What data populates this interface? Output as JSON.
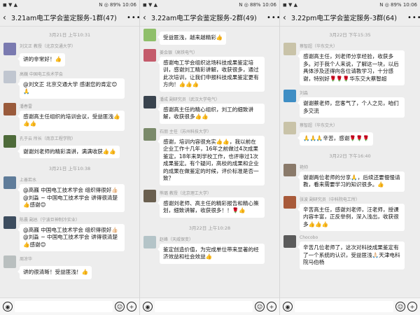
{
  "status": [
    "◼ ▼ ▲",
    "🔋89% ■■ 10:06"
  ],
  "panels": [
    {
      "status_left": "◼ ▼ ▲",
      "status_right": "N ◎ 89%  10:06",
      "title": "3.21am电工学会鉴定服务-1群(47)",
      "messages": [
        {
          "type": "ts",
          "text": "3月21日 上午10:31"
        },
        {
          "type": "msg",
          "avatar": "#7a7ab0",
          "name": "刘文正 教授（北京交通大学）",
          "text": "讲的非常好！👍"
        },
        {
          "type": "msg",
          "avatar": "#c0c6d0",
          "name": "高巍 中国电工技术学会",
          "text": "@刘文正  北京交通大学 感谢您的肯定😊🙏"
        },
        {
          "type": "msg",
          "avatar": "#9a5b3c",
          "name": "潘春雷",
          "text": "感谢高主任组织的培训会议，受益匪浅👍👍👍"
        },
        {
          "type": "msg",
          "avatar": "#4e6b3a",
          "name": "孔于云 所长（南京工程学院）",
          "text": "谢谢刘老师的精彩演讲，满满收获👍👍"
        },
        {
          "type": "ts",
          "text": "3月21日 上午10:38"
        },
        {
          "type": "msg",
          "avatar": "#5f7c9a",
          "name": "上善若水",
          "text": "@高巍 中国电工技术学会  组织得很好👍🏻@刘淼 ~ 中国电工技术学会 讲得很清楚👍感谢😊"
        },
        {
          "type": "msg",
          "avatar": "#3d4d5f",
          "name": "陈晨 副总（宁波巨神制冷实业）",
          "text": "@高巍 中国电工技术学会  组织得很好👍🏻@刘淼 ~ 中国电工技术学会 讲得很清楚👍感谢😊"
        },
        {
          "type": "msg",
          "avatar": "#b9bfbf",
          "name": "周凉华",
          "text": "讲的很清晰！受益匪浅！👍"
        }
      ]
    },
    {
      "status_left": "◼ ▼ ▲",
      "status_right": "N ◎ 88%  10:06",
      "title": "3.22am电工学会鉴定服务-2群(49)",
      "messages": [
        {
          "type": "msg",
          "avatar": "#8fbf6a",
          "name": "",
          "text": "受益匪浅，越来越精彩👍"
        },
        {
          "type": "msg",
          "avatar": "#c45b6b",
          "name": "姜会银（高铁电气）",
          "text": "感谢电工学会组织这场科技成果鉴定培训，感谢刘工精彩讲解，收获很多，通过此次培训，让我们申报科技成果鉴定更有方向！👍👍👍"
        },
        {
          "type": "msg",
          "avatar": "#39434e",
          "name": "潘成 副研究员（武汉大学电气）",
          "text": "感谢高主任的精心组织，刘工的细致讲解，收获很多👍👍"
        },
        {
          "type": "msg",
          "avatar": "#7a8a6a",
          "name": "石朋 主任（苏州科技大学）",
          "text": "感谢，培训内容很充实👍👍，我以前在企业工作十几年，16年之前做过4次成果鉴定，18年来到学校工作，也评审过1次成果鉴定。有个疑问，高校的成果和企业的成果在做鉴定的时候，评价标准是否一致？"
        },
        {
          "type": "msg",
          "avatar": "#6a5f4f",
          "name": "熊璐 教授（北京理工大学）",
          "text": "感谢刘老师、高主任的精彩报告和精心策划，细致讲解，收获很多！！🌹👍"
        },
        {
          "type": "ts",
          "text": "3月22日 上午10:28"
        },
        {
          "type": "msg",
          "avatar": "#b4c4c8",
          "name": "赵峰（天威保变）",
          "text": "鉴定创造价值，为完成单位带来显著的经济效益和社会效益👍"
        }
      ]
    },
    {
      "status_left": "◼ ▼ ▲",
      "status_right": "N ◎ 89%  10:06",
      "title": "3.22pm电工学会鉴定服务-3群(64)",
      "messages": [
        {
          "type": "ts",
          "text": "3月22日 下午15:35"
        },
        {
          "type": "msg",
          "avatar": "#c9c3a8",
          "name": "蔡智超（华东交大）",
          "text": "感谢高主任，刘老师分享经验，收获多多。对于我个人来说，了解这一块，以后具体涉及还得向各位请教学习，十分感谢，特别好🌹🌹🌹华东交大蔡智超"
        },
        {
          "type": "msg",
          "avatar": "#3f8ec4",
          "name": "刘淼",
          "text": "谢谢蔡老师，您客气了，个人之见，咱们多交流"
        },
        {
          "type": "msg",
          "avatar": "#c9c3a8",
          "name": "蔡智超（华东交大）",
          "text": "🙏🙏🙏辛苦，感谢🌹🌹🌹"
        },
        {
          "type": "ts",
          "text": "3月22日 下午16:40"
        },
        {
          "type": "msg",
          "avatar": "#8a7a6a",
          "name": "艳帅",
          "text": "谢谢两位老师的分享🙏，后续还要慢慢请教，看来需要学习的知识很多。👍"
        },
        {
          "type": "msg",
          "avatar": "#a85a3a",
          "name": "张波 副研究员（中科院电工所）",
          "text": "辛苦高主任，感谢刘老师，汪老师，授课内容丰富，正反举例，深入浅出，收获很多👍👍👍"
        },
        {
          "type": "msg",
          "avatar": "#5a5a5a",
          "name": "Chocobo",
          "text": "辛苦几位老师了，这次对科技成果鉴定有了一个系统的认识，受益匪浅🙏🏻天津电科院马伯杨"
        }
      ]
    }
  ]
}
